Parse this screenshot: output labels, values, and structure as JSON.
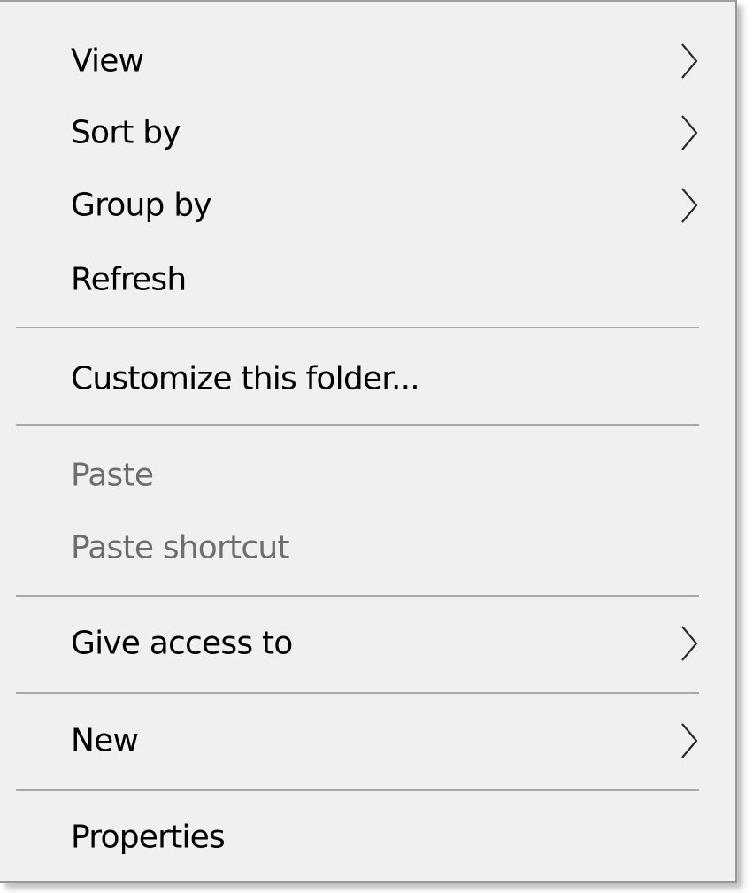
{
  "menu": {
    "items": [
      {
        "label": "View",
        "submenu": true,
        "enabled": true
      },
      {
        "label": "Sort by",
        "submenu": true,
        "enabled": true
      },
      {
        "label": "Group by",
        "submenu": true,
        "enabled": true
      },
      {
        "label": "Refresh",
        "submenu": false,
        "enabled": true
      },
      {
        "label": "Customize this folder...",
        "submenu": false,
        "enabled": true
      },
      {
        "label": "Paste",
        "submenu": false,
        "enabled": false
      },
      {
        "label": "Paste shortcut",
        "submenu": false,
        "enabled": false
      },
      {
        "label": "Give access to",
        "submenu": true,
        "enabled": true
      },
      {
        "label": "New",
        "submenu": true,
        "enabled": true
      },
      {
        "label": "Properties",
        "submenu": false,
        "enabled": true
      }
    ],
    "colors": {
      "background": "#f0f0f0",
      "text": "#000000",
      "disabled_text": "#6d6d6d",
      "separator": "#a8a8a8",
      "chevron": "#2a2a2a"
    }
  }
}
